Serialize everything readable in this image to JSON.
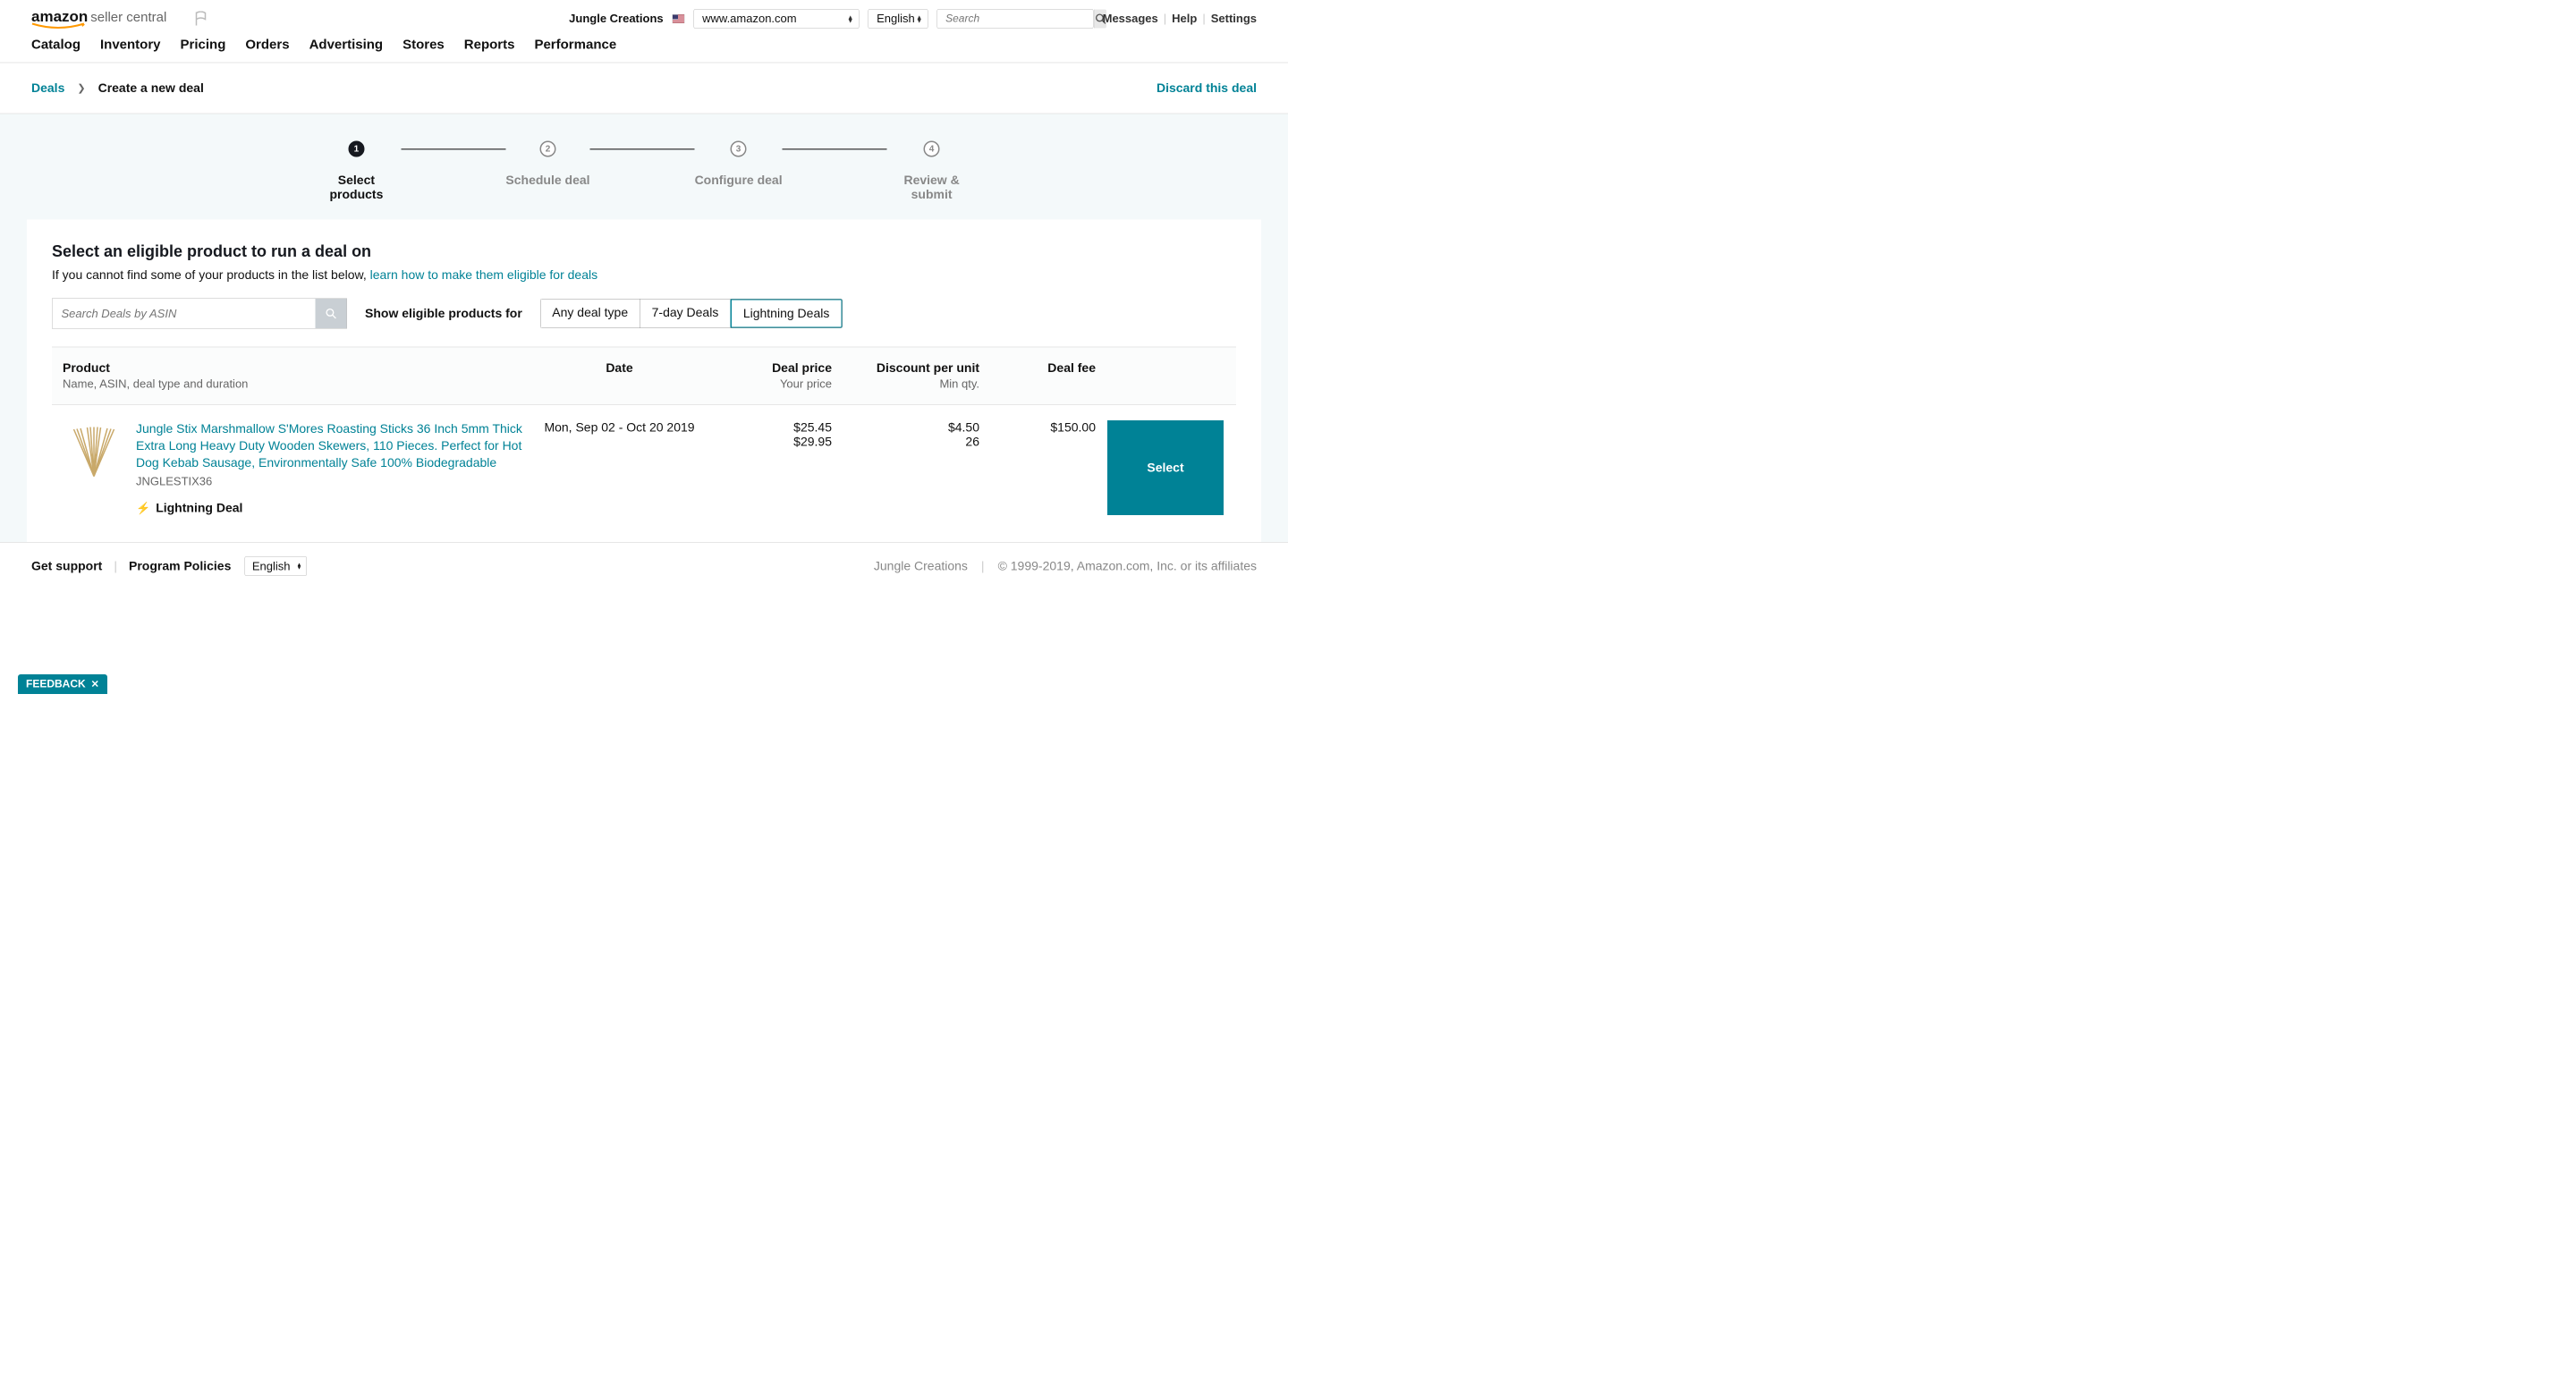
{
  "header": {
    "store": "Jungle Creations",
    "marketplace": "www.amazon.com",
    "language": "English",
    "search_placeholder": "Search",
    "links": {
      "messages": "Messages",
      "help": "Help",
      "settings": "Settings"
    }
  },
  "nav": [
    "Catalog",
    "Inventory",
    "Pricing",
    "Orders",
    "Advertising",
    "Stores",
    "Reports",
    "Performance"
  ],
  "breadcrumb": {
    "root": "Deals",
    "current": "Create a new deal",
    "discard": "Discard this deal"
  },
  "steps": [
    "Select products",
    "Schedule deal",
    "Configure deal",
    "Review & submit"
  ],
  "section": {
    "title": "Select an eligible product to run a deal on",
    "sub_prefix": "If you cannot find some of your products in the list below, ",
    "sub_link": "learn how to make them eligible for deals",
    "asin_placeholder": "Search Deals by ASIN",
    "filter_label": "Show eligible products for",
    "filters": [
      "Any deal type",
      "7-day Deals",
      "Lightning Deals"
    ]
  },
  "table": {
    "headers": {
      "product": "Product",
      "product_sub": "Name, ASIN, deal type and duration",
      "date": "Date",
      "price": "Deal price",
      "price_sub": "Your price",
      "discount": "Discount per unit",
      "discount_sub": "Min qty.",
      "fee": "Deal fee"
    },
    "row": {
      "title": "Jungle Stix Marshmallow S'Mores Roasting Sticks 36 Inch 5mm Thick Extra Long Heavy Duty Wooden Skewers, 110 Pieces. Perfect for Hot Dog Kebab Sausage, Environmentally Safe 100% Biodegradable",
      "sku": "JNGLESTIX36",
      "deal_type": "Lightning Deal",
      "date": "Mon, Sep 02 - Oct 20 2019",
      "deal_price": "$25.45",
      "your_price": "$29.95",
      "discount": "$4.50",
      "min_qty": "26",
      "fee": "$150.00",
      "select": "Select"
    }
  },
  "footer": {
    "support": "Get support",
    "policies": "Program Policies",
    "language": "English",
    "store": "Jungle Creations",
    "copyright": "© 1999-2019, Amazon.com, Inc. or its affiliates",
    "feedback": "FEEDBACK"
  }
}
